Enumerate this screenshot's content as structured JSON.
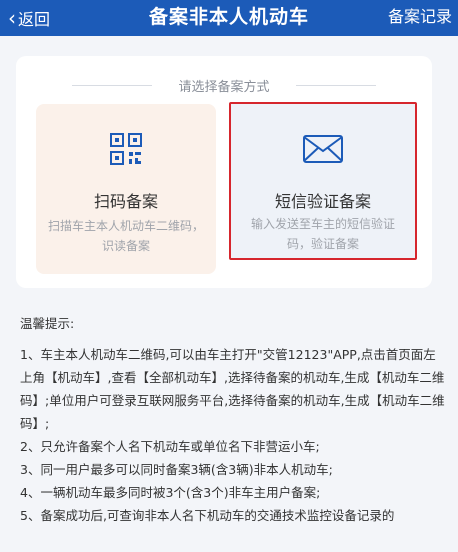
{
  "nav": {
    "back": "返回",
    "title": "备案非本人机动车",
    "right": "备案记录"
  },
  "select": {
    "hint": "请选择备案方式",
    "options": [
      {
        "title": "扫码备案",
        "desc": "扫描车主本人机动车二维码，识读备案",
        "icon": "qr-code-icon"
      },
      {
        "title": "短信验证备案",
        "desc": "输入发送至车主的短信验证码，验证备案",
        "icon": "envelope-icon"
      }
    ]
  },
  "tips": {
    "title": "温馨提示:",
    "items": [
      "1、车主本人机动车二维码,可以由车主打开\"交管12123\"APP,点击首页面左上角【机动车】,查看【全部机动车】,选择待备案的机动车,生成【机动车二维码】;单位用户可登录互联网服务平台,选择待备案的机动车,生成【机动车二维码】;",
      "2、只允许备案个人名下机动车或单位名下非营运小车;",
      "3、同一用户最多可以同时备案3辆(含3辆)非本人机动车;",
      "4、一辆机动车最多同时被3个(含3个)非车主用户备案;",
      "5、备案成功后,可查询非本人名下机动车的交通技术监控设备记录的"
    ]
  },
  "colors": {
    "nav": "#1c5bb8",
    "highlight": "#d6262d",
    "icon": "#1c5bb8"
  }
}
